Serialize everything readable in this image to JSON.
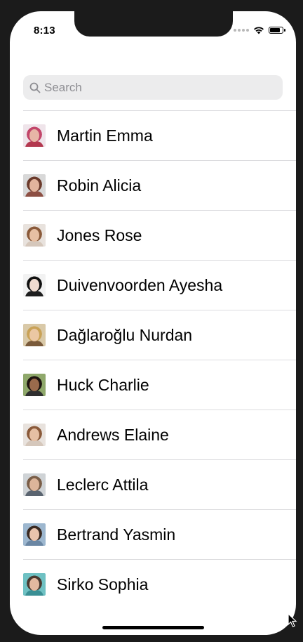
{
  "status": {
    "time": "8:13"
  },
  "search": {
    "placeholder": "Search"
  },
  "contacts": [
    {
      "name": "Martin Emma",
      "hair": "#c2466a",
      "skin": "#e7b6a6",
      "bg": "#efe4ea",
      "shirt": "#b3384f"
    },
    {
      "name": "Robin Alicia",
      "hair": "#6b3b2c",
      "skin": "#e2b49c",
      "bg": "#d8d8d8",
      "shirt": "#8c4f43"
    },
    {
      "name": "Jones Rose",
      "hair": "#8a5a3a",
      "skin": "#e6bfa3",
      "bg": "#e8e2dd",
      "shirt": "#d5c7bb"
    },
    {
      "name": "Duivenvoorden Ayesha",
      "hair": "#111111",
      "skin": "#f0dcd0",
      "bg": "#f2f2f2",
      "shirt": "#1e1e1e"
    },
    {
      "name": "Dağlaroğlu Nurdan",
      "hair": "#c9a257",
      "skin": "#ebc7a3",
      "bg": "#d9c9a8",
      "shirt": "#7a5a3a"
    },
    {
      "name": "Huck Charlie",
      "hair": "#1e1410",
      "skin": "#9a6b4c",
      "bg": "#8fa86b",
      "shirt": "#2f2f2f"
    },
    {
      "name": "Andrews Elaine",
      "hair": "#8a5a3a",
      "skin": "#e6bfa3",
      "bg": "#e8e2dd",
      "shirt": "#d5c7bb"
    },
    {
      "name": "Leclerc Attila",
      "hair": "#7a5e48",
      "skin": "#dcb59a",
      "bg": "#cfd3d6",
      "shirt": "#5a6470"
    },
    {
      "name": "Bertrand Yasmin",
      "hair": "#3a2a22",
      "skin": "#e8c3ad",
      "bg": "#9db7cf",
      "shirt": "#6a86a3"
    },
    {
      "name": "Sirko Sophia",
      "hair": "#4a3a30",
      "skin": "#e3b9a0",
      "bg": "#6fc1c3",
      "shirt": "#3a8f94"
    }
  ]
}
